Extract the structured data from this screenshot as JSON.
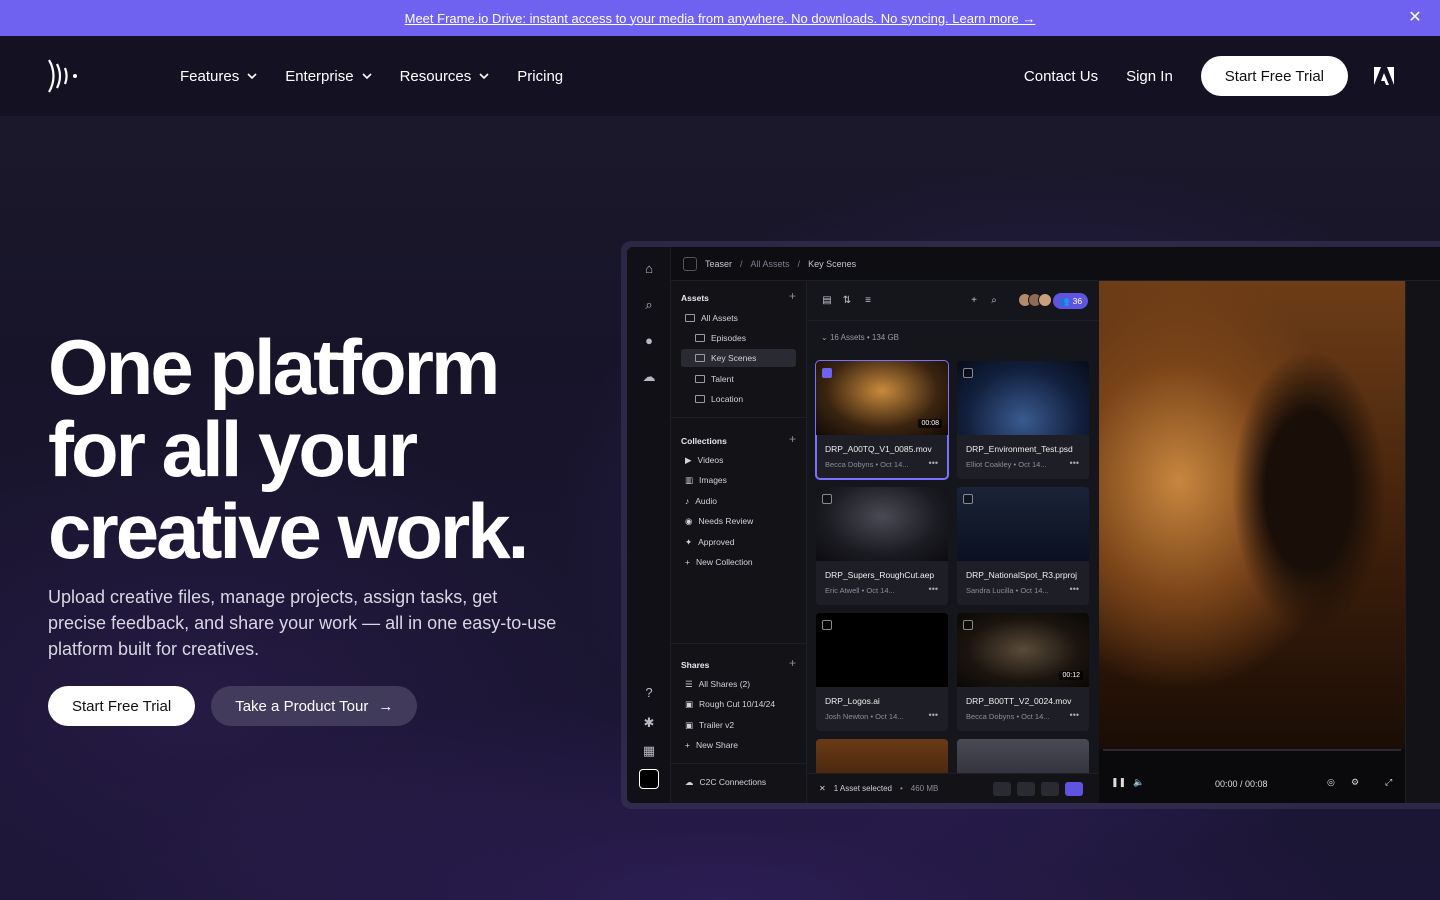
{
  "banner": {
    "text": "Meet Frame.io Drive: instant access to your media from anywhere. No downloads. No syncing. Learn more →",
    "close": "✕"
  },
  "nav": {
    "links": [
      "Features",
      "Enterprise",
      "Resources",
      "Pricing"
    ],
    "contact": "Contact Us",
    "signin": "Sign In",
    "cta": "Start Free Trial"
  },
  "hero": {
    "title_line1": "One platform",
    "title_line2": "for all your",
    "title_line3": "creative work.",
    "subtitle": "Upload creative files, manage projects, assign tasks, get precise feedback, and share your work — all in one easy-to-use platform built for creatives.",
    "cta_primary": "Start Free Trial",
    "cta_secondary": "Take a Product Tour",
    "arrow": "→"
  },
  "app": {
    "breadcrumb": {
      "project": "Teaser",
      "sep": "/",
      "all": "All Assets",
      "current": "Key Scenes"
    },
    "assets_header": "Assets",
    "asset_folders": [
      "All Assets",
      "Episodes",
      "Key Scenes",
      "Talent",
      "Location"
    ],
    "collections_header": "Collections",
    "collections": [
      "Videos",
      "Images",
      "Audio",
      "Needs Review",
      "Approved",
      "New Collection"
    ],
    "shares_header": "Shares",
    "shares": [
      "All Shares (2)",
      "Rough Cut 10/14/24",
      "Trailer v2",
      "New Share"
    ],
    "c2c": "C2C Connections",
    "people_count": "36",
    "asset_count": "16 Assets",
    "asset_size": "134 GB",
    "cards": [
      {
        "name": "DRP_A00TQ_V1_0085.mov",
        "author": "Becca Dobyns",
        "date": "Oct 14...",
        "duration": "00:08"
      },
      {
        "name": "DRP_Environment_Test.psd",
        "author": "Elliot Coakley",
        "date": "Oct 14...",
        "duration": ""
      },
      {
        "name": "DRP_Supers_RoughCut.aep",
        "author": "Eric Atwell",
        "date": "Oct 14...",
        "duration": ""
      },
      {
        "name": "DRP_NationalSpot_R3.prproj",
        "author": "Sandra Lucilla",
        "date": "Oct 14...",
        "duration": ""
      },
      {
        "name": "DRP_Logos.ai",
        "author": "Josh Newton",
        "date": "Oct 14...",
        "duration": ""
      },
      {
        "name": "DRP_B00TT_V2_0024.mov",
        "author": "Becca Dobyns",
        "date": "Oct 14...",
        "duration": "00:12"
      }
    ],
    "selection": "1 Asset selected",
    "selection_size": "460 MB",
    "timecode": "00:00 / 00:08"
  },
  "colors": {
    "banner": "#6f62f0",
    "accent": "#5f54e0"
  }
}
